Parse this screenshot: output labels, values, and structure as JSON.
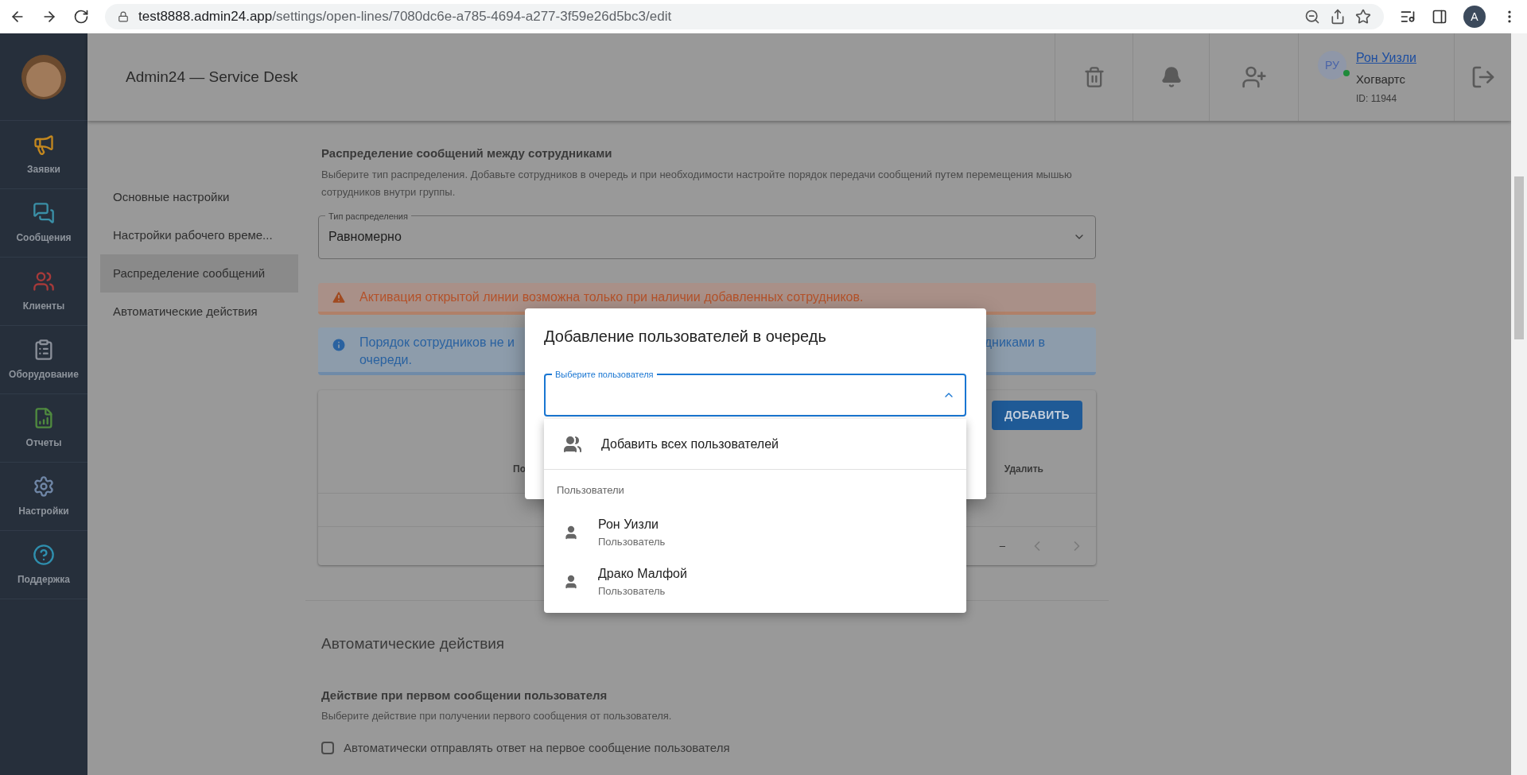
{
  "browser": {
    "url_host": "test8888.admin24.app",
    "url_path": "/settings/open-lines/7080dc6e-a785-4694-a277-3f59e26d5bc3/edit",
    "profile": "A"
  },
  "sidebar": {
    "items": [
      {
        "label": "Заявки",
        "kind": "megaphone"
      },
      {
        "label": "Сообщения",
        "kind": "chat"
      },
      {
        "label": "Клиенты",
        "kind": "clients"
      },
      {
        "label": "Оборудование",
        "kind": "equipment"
      },
      {
        "label": "Отчеты",
        "kind": "reports"
      },
      {
        "label": "Настройки",
        "kind": "settings"
      },
      {
        "label": "Поддержка",
        "kind": "support"
      }
    ]
  },
  "header": {
    "title": "Admin24 — Service Desk",
    "user": {
      "initials": "РУ",
      "name": "Рон Уизли",
      "org": "Хогвартс",
      "id": "ID: 11944",
      "online": true
    }
  },
  "nav": {
    "items": [
      {
        "label": "Основные настройки",
        "selected": false
      },
      {
        "label": "Настройки рабочего време...",
        "selected": false
      },
      {
        "label": "Распределение сообщений",
        "selected": true
      },
      {
        "label": "Автоматические действия",
        "selected": false
      }
    ]
  },
  "section": {
    "title": "Распределение сообщений между сотрудниками",
    "description": "Выберите тип распределения. Добавьте сотрудников в очередь и при необходимости настройте порядок передачи сообщений путем перемещения мышью сотрудников внутри группы.",
    "select": {
      "label": "Тип распределения",
      "value": "Равномерно"
    },
    "warning": "Активация открытой линии возможна только при наличии добавленных сотрудников.",
    "info": {
      "part_1": "Порядок сотрудников не и",
      "part_2": "дниками в",
      "part_3": "очереди."
    },
    "table": {
      "add_button": "ДОБАВИТЬ",
      "column_1": "По",
      "column_2": "Удалить",
      "pagination": "–"
    }
  },
  "auto_actions": {
    "title": "Автоматические действия",
    "subtitle": "Действие при первом сообщении пользователя",
    "description": "Выберите действие при получении первого сообщения от пользователя.",
    "checkbox": {
      "label": "Автоматически отправлять ответ на первое сообщение пользователя",
      "checked": false
    }
  },
  "dialog": {
    "title": "Добавление пользователей в очередь",
    "field_label": "Выберите пользователя",
    "expanded": true,
    "add_all": "Добавить всех пользователей",
    "group": "Пользователи",
    "users": [
      {
        "name": "Рон Уизли",
        "role": "Пользователь"
      },
      {
        "name": "Драко Малфой",
        "role": "Пользователь"
      }
    ]
  }
}
